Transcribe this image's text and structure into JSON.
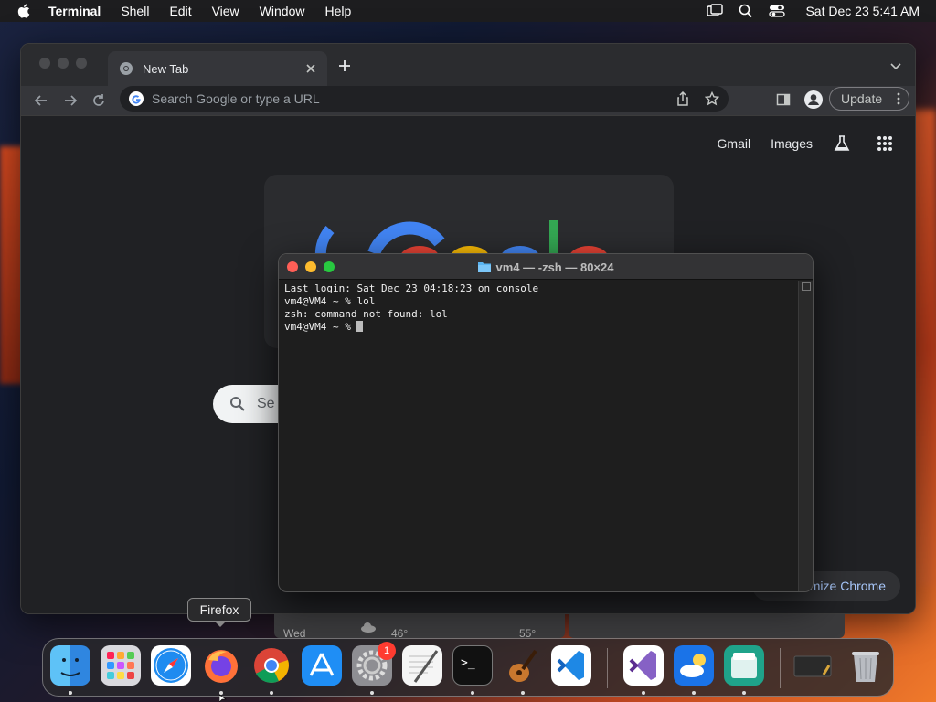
{
  "menubar": {
    "app_name": "Terminal",
    "items": [
      "Shell",
      "Edit",
      "View",
      "Window",
      "Help"
    ],
    "clock": "Sat Dec 23  5:41 AM"
  },
  "chrome": {
    "tab_title": "New Tab",
    "omnibox_placeholder": "Search Google or type a URL",
    "update_label": "Update",
    "links": {
      "gmail": "Gmail",
      "images": "Images"
    },
    "search_placeholder": "Se",
    "customize_label": "omize Chrome"
  },
  "strip": {
    "day": "Wed",
    "temp1": "46°",
    "temp2": "55°"
  },
  "terminal": {
    "title": "vm4 — -zsh — 80×24",
    "lines": [
      "Last login: Sat Dec 23 04:18:23 on console",
      "vm4@VM4 ~ % lol",
      "zsh: command not found: lol",
      "vm4@VM4 ~ % "
    ]
  },
  "dock": {
    "tooltip": "Firefox",
    "badge_count": "1"
  },
  "colors": {
    "close": "#ff5f57",
    "minimize": "#febc2e",
    "zoom": "#28c840",
    "link_blue": "#a8c7fa"
  }
}
